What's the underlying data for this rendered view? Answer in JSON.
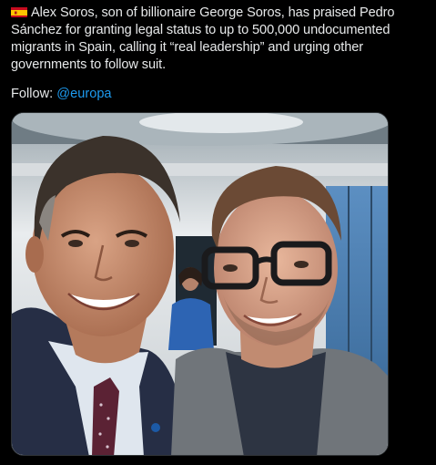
{
  "tweet": {
    "flag_icon": "spain-flag-icon",
    "body": "Alex Soros, son of billionaire George Soros, has praised Pedro Sánchez for granting legal status to up to 500,000 undocumented migrants in Spain, calling it “real leadership” and urging other governments to follow suit.",
    "follow_label": "Follow:",
    "follow_handle": "@europa"
  },
  "media": {
    "kind": "photo"
  },
  "colors": {
    "background": "#000000",
    "text": "#e7e9ea",
    "link": "#1d9bf0",
    "flag_red": "#c60b1e",
    "flag_yellow": "#ffc400"
  }
}
